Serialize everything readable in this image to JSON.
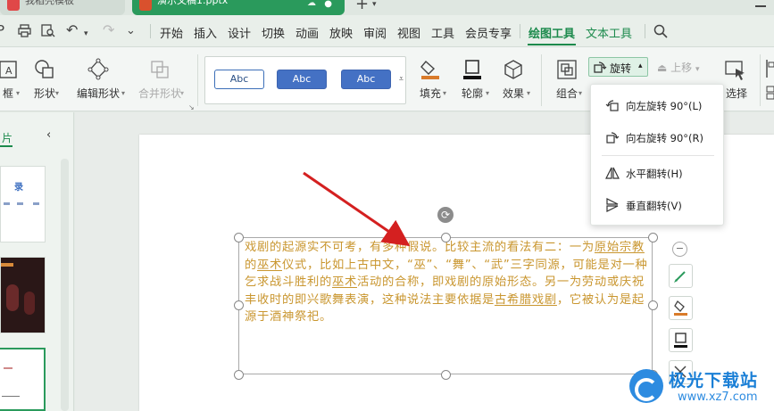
{
  "tabs": [
    {
      "label": "我稻壳模板"
    },
    {
      "label": "演示文稿1.pptx"
    }
  ],
  "menu": {
    "items": [
      "开始",
      "插入",
      "设计",
      "切换",
      "动画",
      "放映",
      "审阅",
      "视图",
      "工具",
      "会员专享"
    ],
    "drawing_tools": "绘图工具",
    "text_tools": "文本工具"
  },
  "ribbon": {
    "text_box_partial": "框",
    "shape": "形状",
    "edit_shape": "编辑形状",
    "merge_shape": "合并形状",
    "style_sample": "Abc",
    "fill": "填充",
    "outline": "轮廓",
    "effect": "效果",
    "group": "组合",
    "rotate": "旋转",
    "move_up": "上移",
    "select_partial": "选择"
  },
  "rotate_menu": {
    "items": [
      {
        "label": "向左旋转 90°(L)"
      },
      {
        "label": "向右旋转 90°(R)"
      },
      {
        "label": "水平翻转(H)"
      },
      {
        "label": "垂直翻转(V)"
      }
    ]
  },
  "left_panel": {
    "title_partial": "片",
    "thumb1_text": "录"
  },
  "slide": {
    "seg1": "戏剧的起源实不可考，有多种假说。比较主流的看法有二：一为",
    "link1": "原始宗教",
    "seg2": "的",
    "link2": "巫术",
    "seg3": "仪式，比如上古中文，“巫”、“舞”、“武”三字同源，可能是对一种乞求战斗胜利的",
    "link3": "巫术",
    "seg4": "活动的合称，即戏剧的原始形态。另一为劳动或庆祝丰收时的即兴歌舞表演，这种说法主要依据是",
    "link4": "古希腊戏剧",
    "seg5": "，它被认为是起源于酒神祭祀。",
    "text_color": "#c9962f"
  },
  "watermark": {
    "name": "极光下载站",
    "url": "www.xz7.com"
  },
  "colors": {
    "accent": "#1c8a4c",
    "arrow": "#d42020"
  }
}
